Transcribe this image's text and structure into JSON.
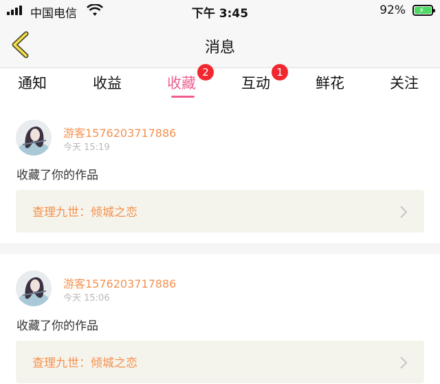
{
  "status_bar": {
    "carrier": "中国电信",
    "time": "下午 3:45",
    "battery_percent": "92%",
    "battery_level": 0.92
  },
  "header": {
    "title": "消息",
    "back_icon": "chevron-left-icon"
  },
  "tabs": [
    {
      "label": "通知"
    },
    {
      "label": "收益"
    },
    {
      "label": "收藏",
      "badge": "2",
      "active": true
    },
    {
      "label": "互动",
      "badge": "1"
    },
    {
      "label": "鲜花"
    },
    {
      "label": "关注"
    }
  ],
  "colors": {
    "accent_pink": "#ee5f8f",
    "username_orange": "#f4904e",
    "badge_red": "#f1282f",
    "work_box_bg": "#f5f4ec"
  },
  "messages": [
    {
      "username": "游客1576203717886",
      "time": "今天 15:19",
      "action": "收藏了你的作品",
      "work": "查理九世：倾城之恋"
    },
    {
      "username": "游客1576203717886",
      "time": "今天 15:06",
      "action": "收藏了你的作品",
      "work": "查理九世：倾城之恋"
    }
  ]
}
